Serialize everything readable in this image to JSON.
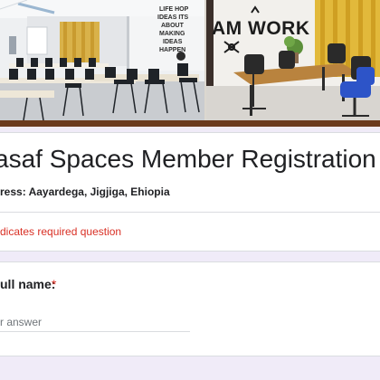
{
  "banner": {
    "right_photo_text": "AM WORK",
    "wall_words": [
      "LIFE HOP",
      "IDEAS ITS",
      "ABOUT",
      "MAKING",
      "IDEAS",
      "HAPPEN"
    ]
  },
  "form": {
    "title": "asaf Spaces Member Registration form",
    "address": "ress: Aayardega, Jigjiga, Ehiopia",
    "required_note": "dicates required question"
  },
  "question": {
    "label": "ull name:",
    "required_marker": "*",
    "placeholder": "r answer"
  },
  "colors": {
    "banner_rule": "#6b3a1e",
    "required_red": "#d93025",
    "background": "#f0ebf8"
  }
}
